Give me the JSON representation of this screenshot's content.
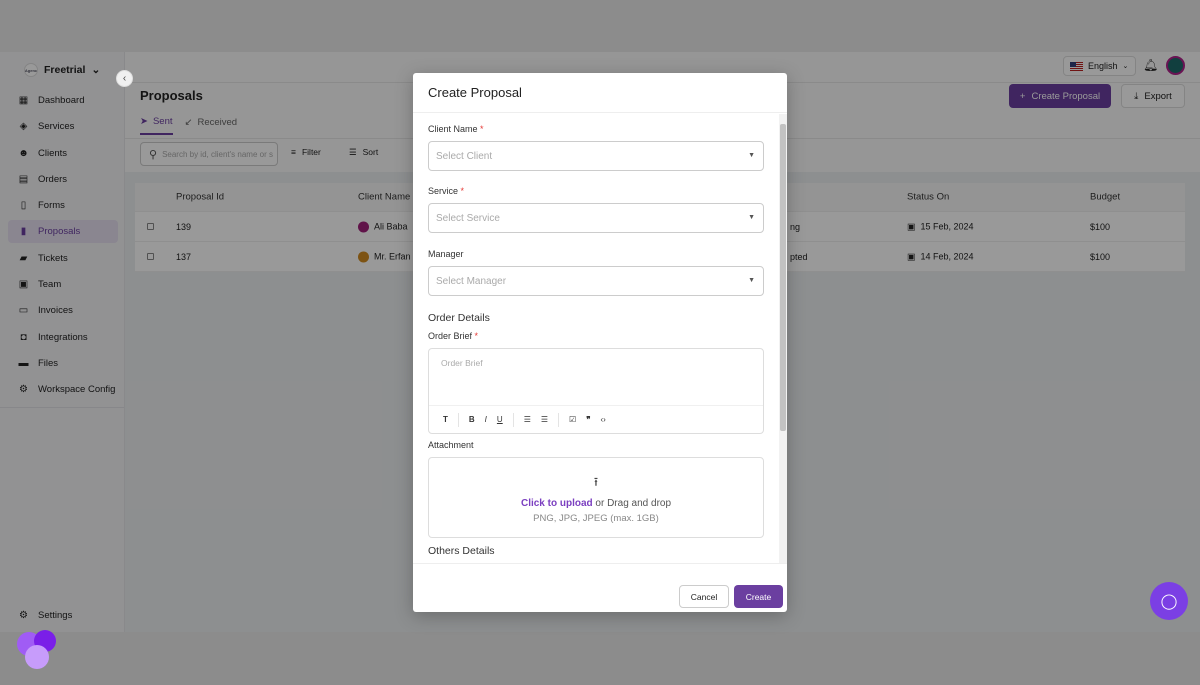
{
  "workspace": {
    "name": "Freetrial",
    "logo_text": "Agenc"
  },
  "sidebar": {
    "items": [
      {
        "label": "Dashboard",
        "icon": "dashboard-icon",
        "glyph": "▦"
      },
      {
        "label": "Services",
        "icon": "box-icon",
        "glyph": "◈"
      },
      {
        "label": "Clients",
        "icon": "clients-icon",
        "glyph": "☻"
      },
      {
        "label": "Orders",
        "icon": "orders-icon",
        "glyph": "▤"
      },
      {
        "label": "Forms",
        "icon": "forms-icon",
        "glyph": "▯"
      },
      {
        "label": "Proposals",
        "icon": "proposal-icon",
        "glyph": "▮",
        "active": true
      },
      {
        "label": "Tickets",
        "icon": "ticket-icon",
        "glyph": "▰"
      },
      {
        "label": "Team",
        "icon": "team-icon",
        "glyph": "▣"
      },
      {
        "label": "Invoices",
        "icon": "invoice-icon",
        "glyph": "▭"
      },
      {
        "label": "Integrations",
        "icon": "integrations-icon",
        "glyph": "◘"
      },
      {
        "label": "Files",
        "icon": "folder-icon",
        "glyph": "▬"
      },
      {
        "label": "Workspace Config",
        "icon": "workspace-config-icon",
        "glyph": "⚙"
      }
    ],
    "settings": "Settings"
  },
  "topbar": {
    "language": "English"
  },
  "page": {
    "title": "Proposals",
    "create_button": "Create Proposal",
    "export_button": "Export",
    "tabs": [
      {
        "label": "Sent",
        "active": true
      },
      {
        "label": "Received"
      }
    ],
    "search_placeholder": "Search by id, client's name or s",
    "filter": "Filter",
    "sort": "Sort"
  },
  "table": {
    "headers": [
      "Proposal Id",
      "Client Name",
      "Status On",
      "Budget"
    ],
    "rows": [
      {
        "id": "139",
        "client": "Ali Baba",
        "status": "ng",
        "status_on": "15 Feb, 2024",
        "budget": "$100"
      },
      {
        "id": "137",
        "client": "Mr. Erfan",
        "status": "pted",
        "status_on": "14 Feb, 2024",
        "budget": "$100"
      }
    ]
  },
  "modal": {
    "title": "Create Proposal",
    "client_label": "Client Name",
    "client_placeholder": "Select Client",
    "service_label": "Service",
    "service_placeholder": "Select Service",
    "manager_label": "Manager",
    "manager_placeholder": "Select Manager",
    "order_details": "Order Details",
    "order_brief_label": "Order Brief",
    "order_brief_placeholder": "Order Brief",
    "attachment_label": "Attachment",
    "upload_link": "Click to upload",
    "upload_text": " or Drag and drop",
    "upload_hint": "PNG, JPG, JPEG (max. 1GB)",
    "others_details": "Others Details",
    "cancel": "Cancel",
    "create": "Create",
    "required_mark": "*"
  },
  "colors": {
    "accent": "#6b3fa0",
    "required": "#e53935",
    "chat": "#7b3fe4"
  }
}
